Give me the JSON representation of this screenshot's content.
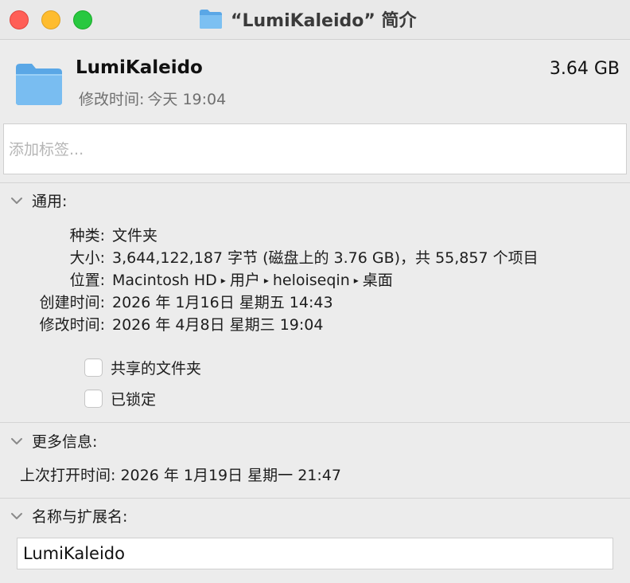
{
  "window": {
    "title": "“LumiKaleido” 简介"
  },
  "file": {
    "name": "LumiKaleido",
    "size": "3.64 GB",
    "modified_label": "修改时间:",
    "modified_value": "今天 19:04"
  },
  "tags": {
    "placeholder": "添加标签..."
  },
  "general": {
    "header": "通用:",
    "rows": [
      {
        "label": "种类:",
        "value": "文件夹"
      },
      {
        "label": "大小:",
        "value": "3,644,122,187 字节 (磁盘上的 3.76 GB)，共 55,857 个项目"
      },
      {
        "label": "位置:",
        "path": [
          "Macintosh HD",
          "用户",
          "heloiseqin",
          "桌面"
        ]
      },
      {
        "label": "创建时间:",
        "value": "2026 年 1月16日 星期五 14:43"
      },
      {
        "label": "修改时间:",
        "value": "2026 年 4月8日 星期三 19:04"
      }
    ],
    "path_separator": "▸",
    "checkboxes": [
      {
        "label": "共享的文件夹",
        "checked": false
      },
      {
        "label": "已锁定",
        "checked": false
      }
    ]
  },
  "more_info": {
    "header": "更多信息:",
    "last_opened": "上次打开时间: 2026 年 1月19日 星期一 21:47"
  },
  "name_ext": {
    "header": "名称与扩展名:",
    "value": "LumiKaleido"
  },
  "colors": {
    "folder_blue": "#6cb3ec",
    "close": "#ff5f57",
    "minimize": "#febc2e",
    "maximize": "#28c840"
  }
}
